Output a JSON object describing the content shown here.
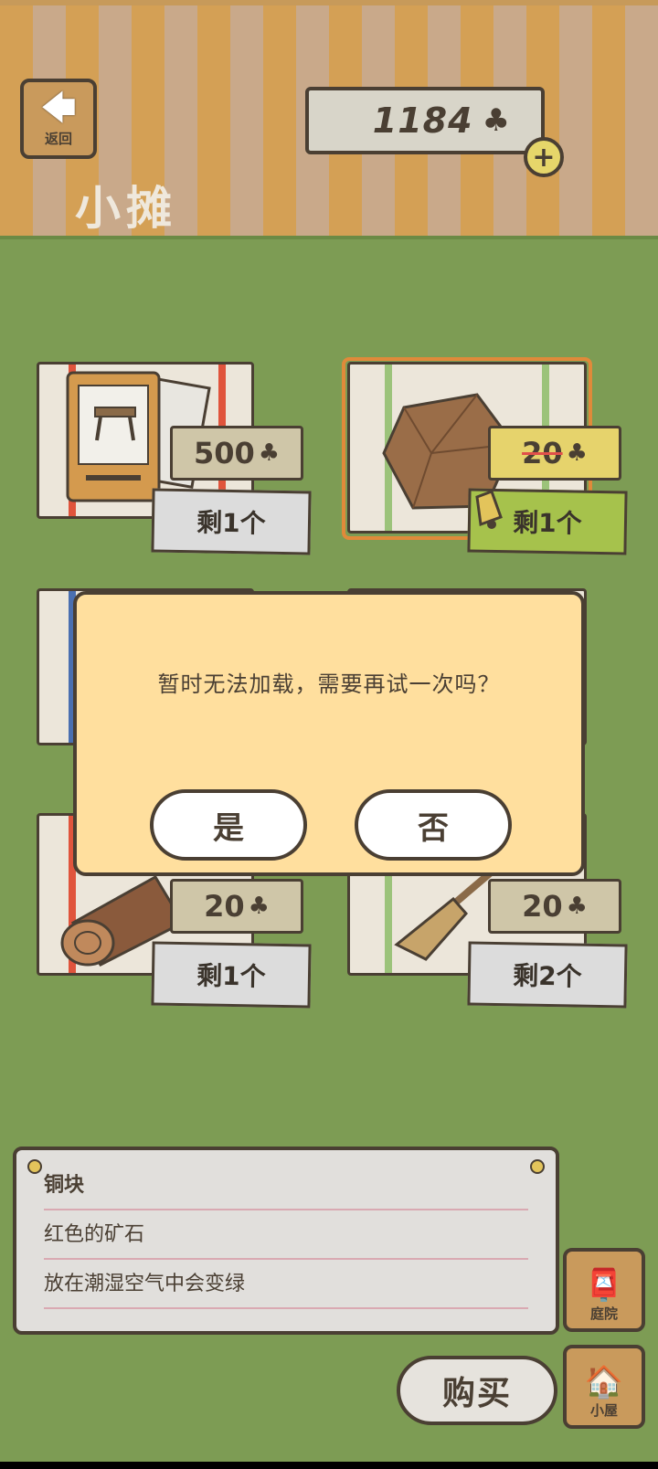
{
  "header": {
    "back_label": "返回",
    "back_icon": "left-arrow-icon",
    "title": "小摊",
    "currency_amount": "1184",
    "currency_icon": "clover-icon",
    "plus_label": "+"
  },
  "items": [
    {
      "name": "table-postcard",
      "price": "500",
      "stock": "剩1个",
      "struck": false
    },
    {
      "name": "copper-ore-bundle",
      "price": "20",
      "stock": "剩1个",
      "struck": true,
      "selected": true
    },
    {
      "name": "log",
      "price": "20",
      "stock": "剩1个",
      "struck": false
    },
    {
      "name": "broom",
      "price": "20",
      "stock": "剩2个",
      "struck": false
    }
  ],
  "clover_glyph": "♣",
  "dialog": {
    "message": "暂时无法加载，需要再试一次吗？",
    "yes_label": "是",
    "no_label": "否"
  },
  "description": {
    "name": "铜块",
    "line1": "红色的矿石",
    "line2": "放在潮湿空气中会变绿"
  },
  "buy_label": "购买",
  "side_buttons": {
    "yard_label": "庭院",
    "house_label": "小屋"
  },
  "colors": {
    "grass": "#7d9c54",
    "dialog": "#ffdf9e",
    "selected_border": "#e08a3a"
  }
}
